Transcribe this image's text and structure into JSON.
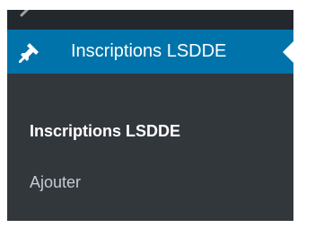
{
  "admin_menu": {
    "active_item": {
      "label": "Inscriptions LSDDE",
      "icon": "pushpin-icon"
    },
    "submenu": [
      {
        "label": "Inscriptions LSDDE",
        "current": true
      },
      {
        "label": "Ajouter",
        "current": false
      }
    ]
  },
  "colors": {
    "sidebar_bg": "#23282d",
    "submenu_bg": "#32373c",
    "active_bg": "#0073aa",
    "active_text": "#ffffff",
    "submenu_text": "#c7cbd1"
  }
}
